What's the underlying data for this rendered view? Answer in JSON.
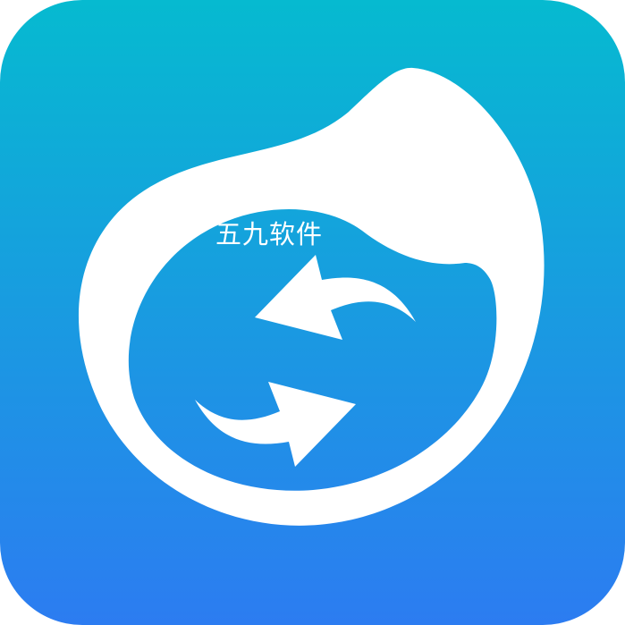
{
  "app_icon": {
    "name": "app-icon",
    "colors": {
      "gradient_top": "#06BAD0",
      "gradient_bottom": "#2C7CF1",
      "glyph": "#FFFFFF"
    },
    "icons": [
      "app-tile-icon",
      "water-drop-icon",
      "sync-arrows-icon",
      "arrow-left-icon",
      "arrow-right-icon"
    ]
  },
  "watermark": {
    "text": "五九软件"
  }
}
